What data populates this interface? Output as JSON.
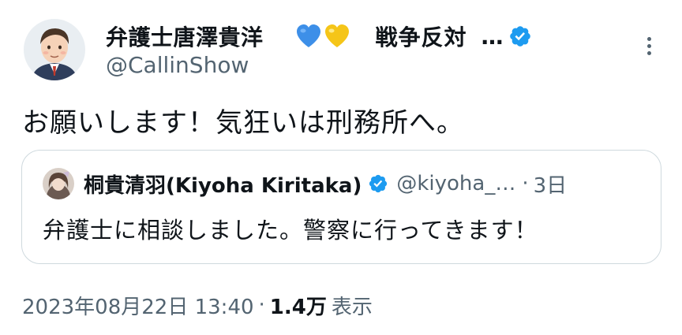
{
  "author": {
    "display_name": "弁護士唐澤貴洋",
    "hearts": [
      "blue-heart",
      "yellow-heart"
    ],
    "name_suffix": "戦争反対",
    "truncation": "…",
    "handle": "@CallinShow",
    "verified": true
  },
  "tweet": {
    "text": "お願いします！気狂いは刑務所へ。"
  },
  "quote": {
    "display_name": "桐貴清羽(Kiyoha Kiritaka)",
    "handle": "@kiyoha_…",
    "separator": "·",
    "time": "3日",
    "text": "弁護士に相談しました。警察に行ってきます！",
    "verified": true
  },
  "meta": {
    "timestamp": "2023年08月22日 13:40",
    "separator": "·",
    "views_count": "1.4万",
    "views_label": "表示"
  },
  "colors": {
    "text_primary": "#0f1419",
    "text_secondary": "#536471",
    "verified_blue": "#1d9bf0",
    "border": "#cfd9de",
    "heart_blue": "#3d8fe8",
    "heart_yellow": "#f5c518"
  },
  "icons": {
    "more": "more-vertical-icon",
    "verified": "verified-badge-icon"
  }
}
